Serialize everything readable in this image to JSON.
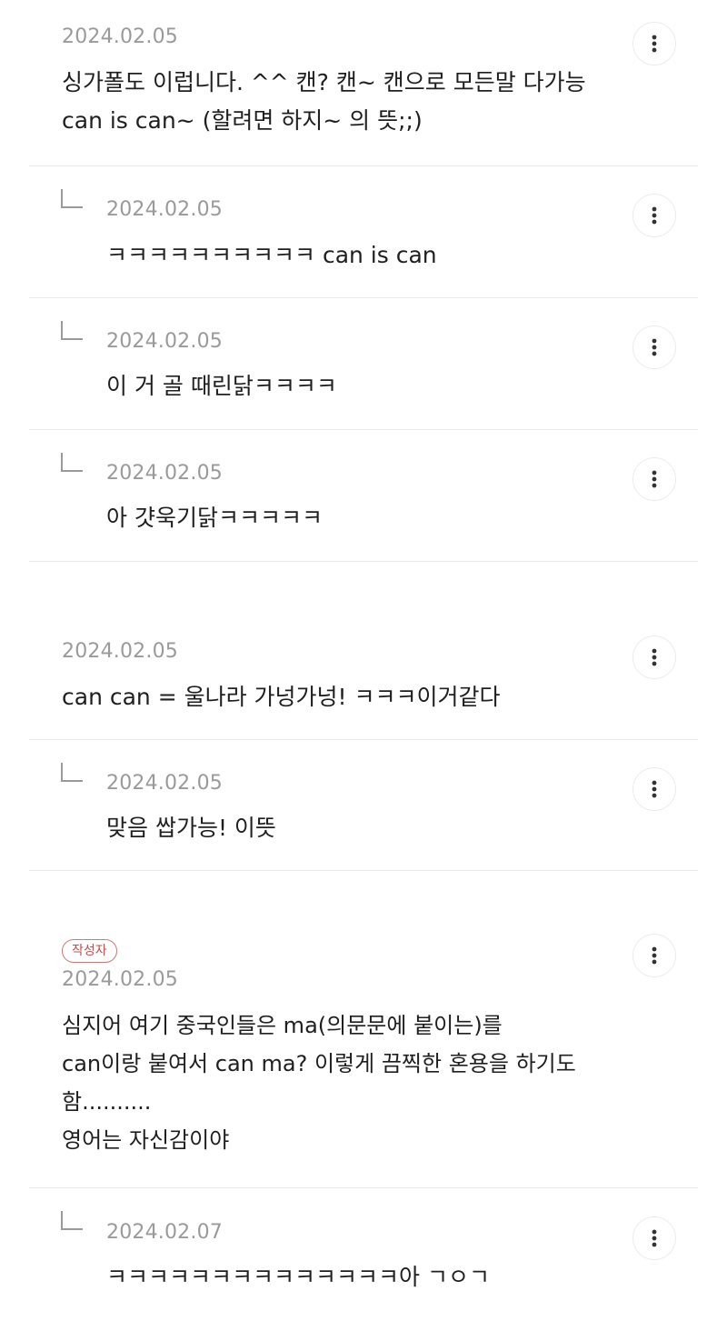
{
  "comments": [
    {
      "date": "2024.02.05",
      "text": "싱가폴도 이럽니다. ^^ 캔? 캔~ 캔으로 모든말 다가능\ncan is can~ (할려면 하지~ 의 뜻;;)"
    },
    {
      "date": "2024.02.05",
      "text": "ㅋㅋㅋㅋㅋㅋㅋㅋㅋㅋ can is can"
    },
    {
      "date": "2024.02.05",
      "text": "이 거 골 때린닭ㅋㅋㅋㅋ"
    },
    {
      "date": "2024.02.05",
      "text": "아 걋욱기닭ㅋㅋㅋㅋㅋ"
    },
    {
      "date": "2024.02.05",
      "text": "can can = 울나라 가넝가넝! ㅋㅋㅋ이거같다"
    },
    {
      "date": "2024.02.05",
      "text": "맞음 쌉가능! 이뜻"
    },
    {
      "badge": "작성자",
      "date": "2024.02.05",
      "text": "심지어 여기 중국인들은 ma(의문문에 붙이는)를\ncan이랑 붙여서 can ma? 이렇게 끔찍한 혼용을 하기도\n함..........\n영어는 자신감이야"
    },
    {
      "date": "2024.02.07",
      "text": "ㅋㅋㅋㅋㅋㅋㅋㅋㅋㅋㅋㅋㅋㅋ아 ㄱㅇㄱ"
    }
  ],
  "icons": {
    "more": "more-vertical-icon",
    "reply": "reply-arrow-icon"
  }
}
